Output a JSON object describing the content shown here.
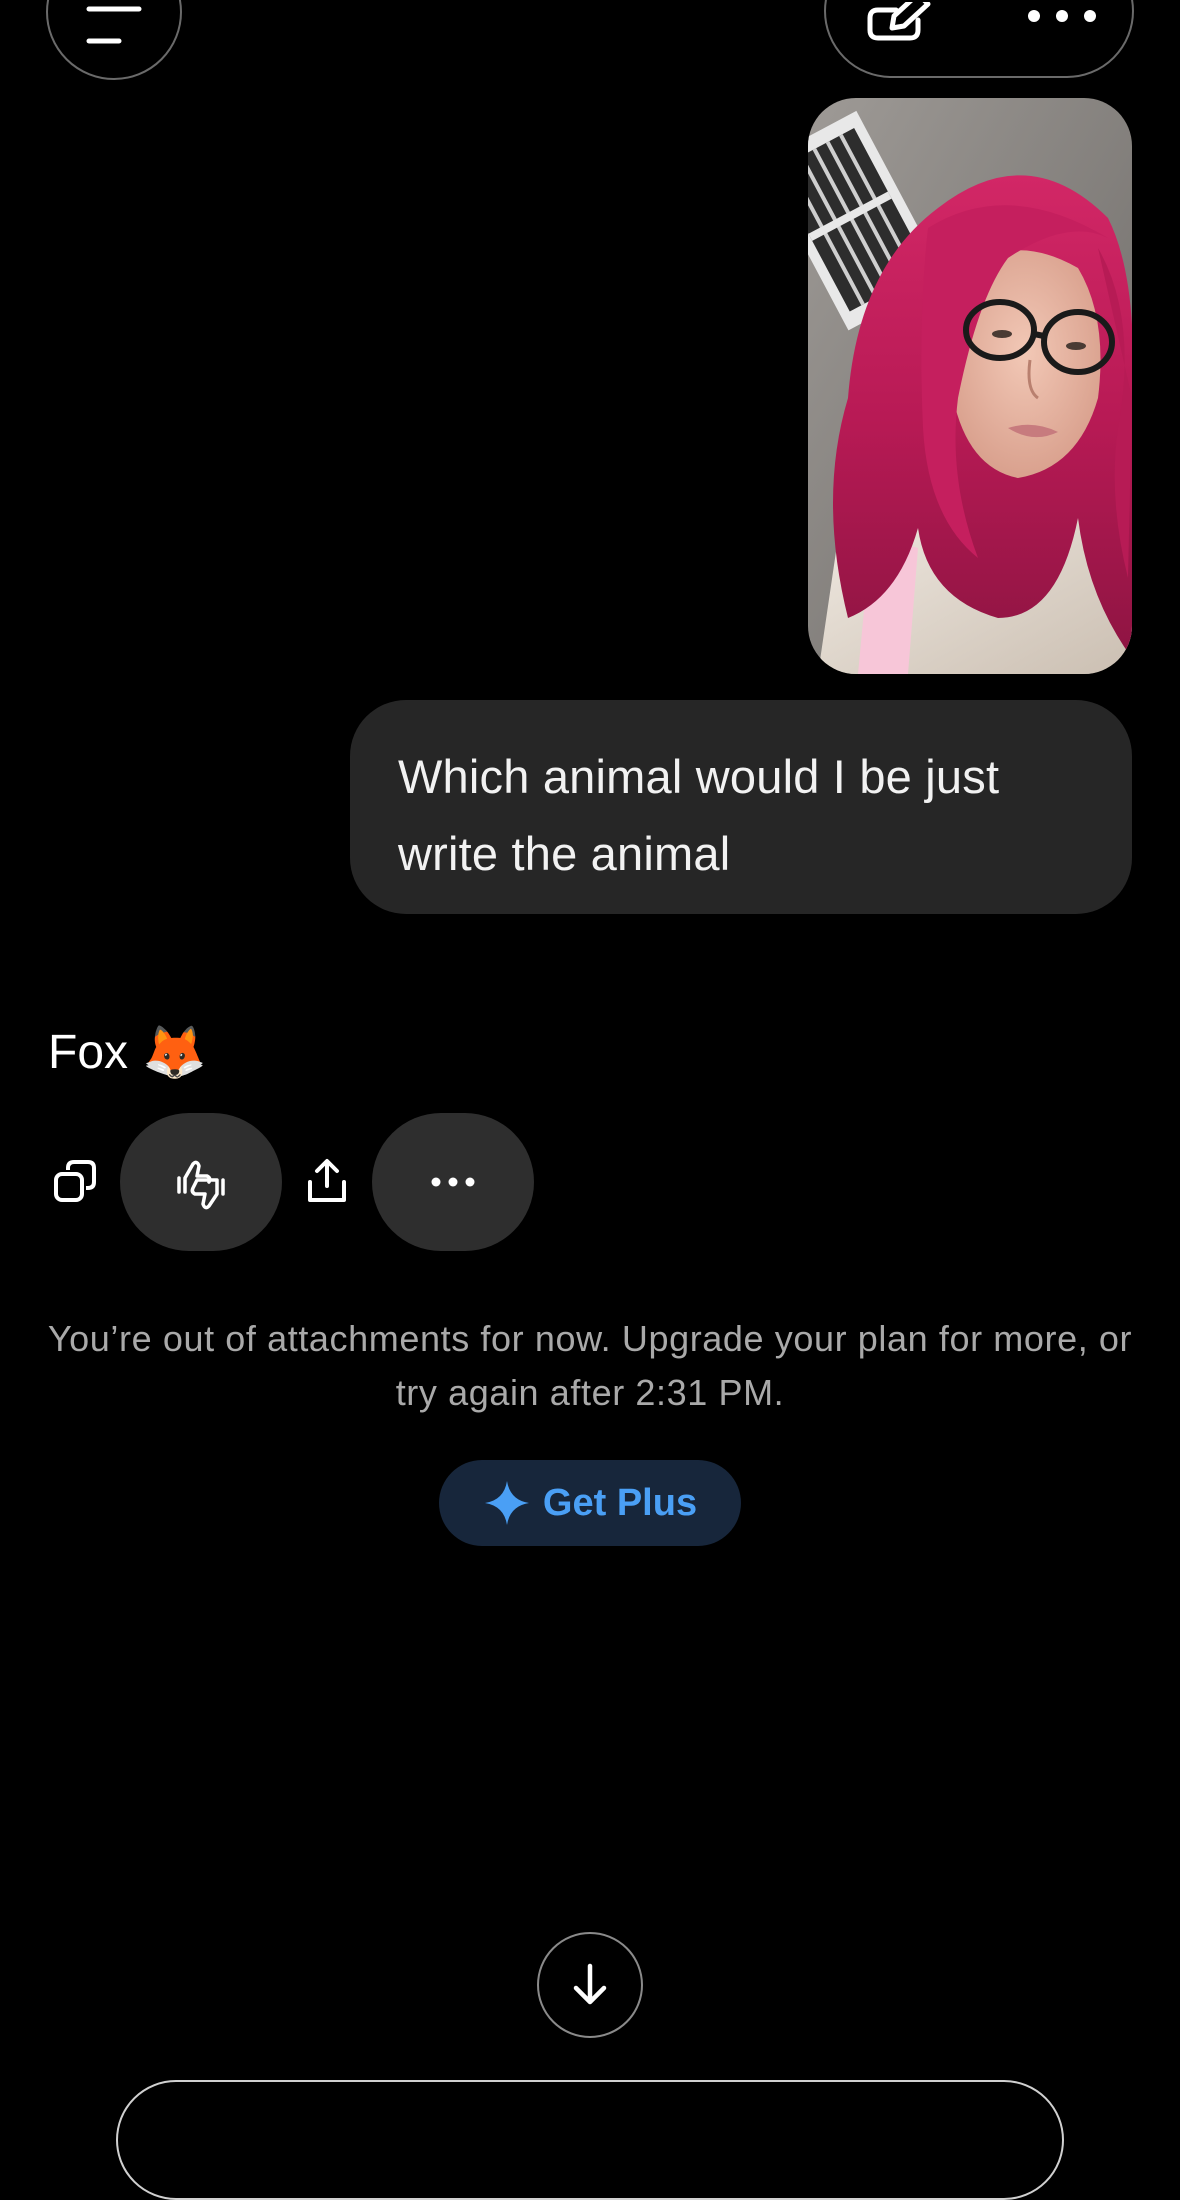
{
  "conversation": {
    "user_message": "Which animal would I be just write the animal",
    "assistant_reply": "Fox",
    "assistant_reply_emoji": "🦊"
  },
  "icons": {
    "menu": "hamburger-menu-icon",
    "new_chat": "edit-icon",
    "more": "more-horizontal-icon",
    "copy": "copy-icon",
    "feedback": "thumbs-up-down-icon",
    "share": "share-icon",
    "scroll": "arrow-down-icon",
    "sparkle": "sparkle-icon"
  },
  "limit_notice": {
    "text": "You’re out of attachments for now. Upgrade your plan for more, or try again after 2:31 PM.",
    "cta_label": "Get Plus"
  },
  "colors": {
    "background": "#000000",
    "bubble": "#262626",
    "accent": "#4a9ff5",
    "cta_background": "#17263b"
  }
}
